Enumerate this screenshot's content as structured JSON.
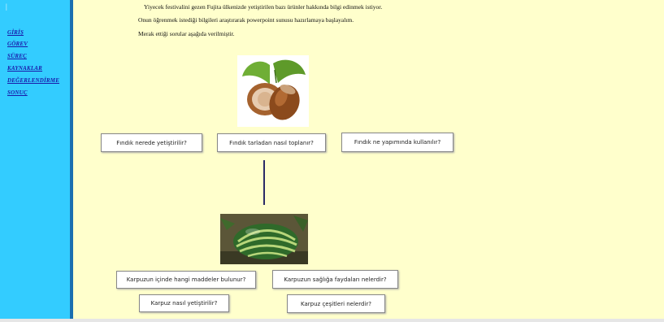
{
  "sidebar": {
    "marker": "|",
    "items": [
      {
        "label": "GİRİŞ"
      },
      {
        "label": "GÖREV"
      },
      {
        "label": "SÜREÇ"
      },
      {
        "label": "KAYNAKLAR"
      },
      {
        "label": "DEĞERLENDİRME"
      },
      {
        "label": "SONUÇ"
      }
    ]
  },
  "intro": {
    "line1": "Yiyecek festivalini gezen Fujita ülkenizde yetiştirilen bazı ürünler hakkında bilgi edinmek istiyor.",
    "line2": "Onun öğrenmek istediği bilgileri araştırarak powerpoint sunusu hazırlamaya başlayalım.",
    "line3": "Merak ettiği sorular aşağıda verilmiştir."
  },
  "hazelnut_questions": [
    "Fındık nerede yetiştirilir?",
    "Fındık tarladan nasıl toplanır?",
    "Fındık ne yapımında kullanılır?"
  ],
  "watermelon_questions": [
    "Karpuzun içinde hangi maddeler bulunur?",
    "Karpuzun sağlığa faydaları nelerdir?",
    "Karpuz nasıl yetiştirilir?",
    "Karpuz çeşitleri nelerdir?"
  ],
  "colors": {
    "page_bg": "#ffffcc",
    "sidebar_bg": "#33ccff",
    "link": "#1a1aaa"
  },
  "images": [
    "hazelnut-image",
    "watermelon-image"
  ]
}
